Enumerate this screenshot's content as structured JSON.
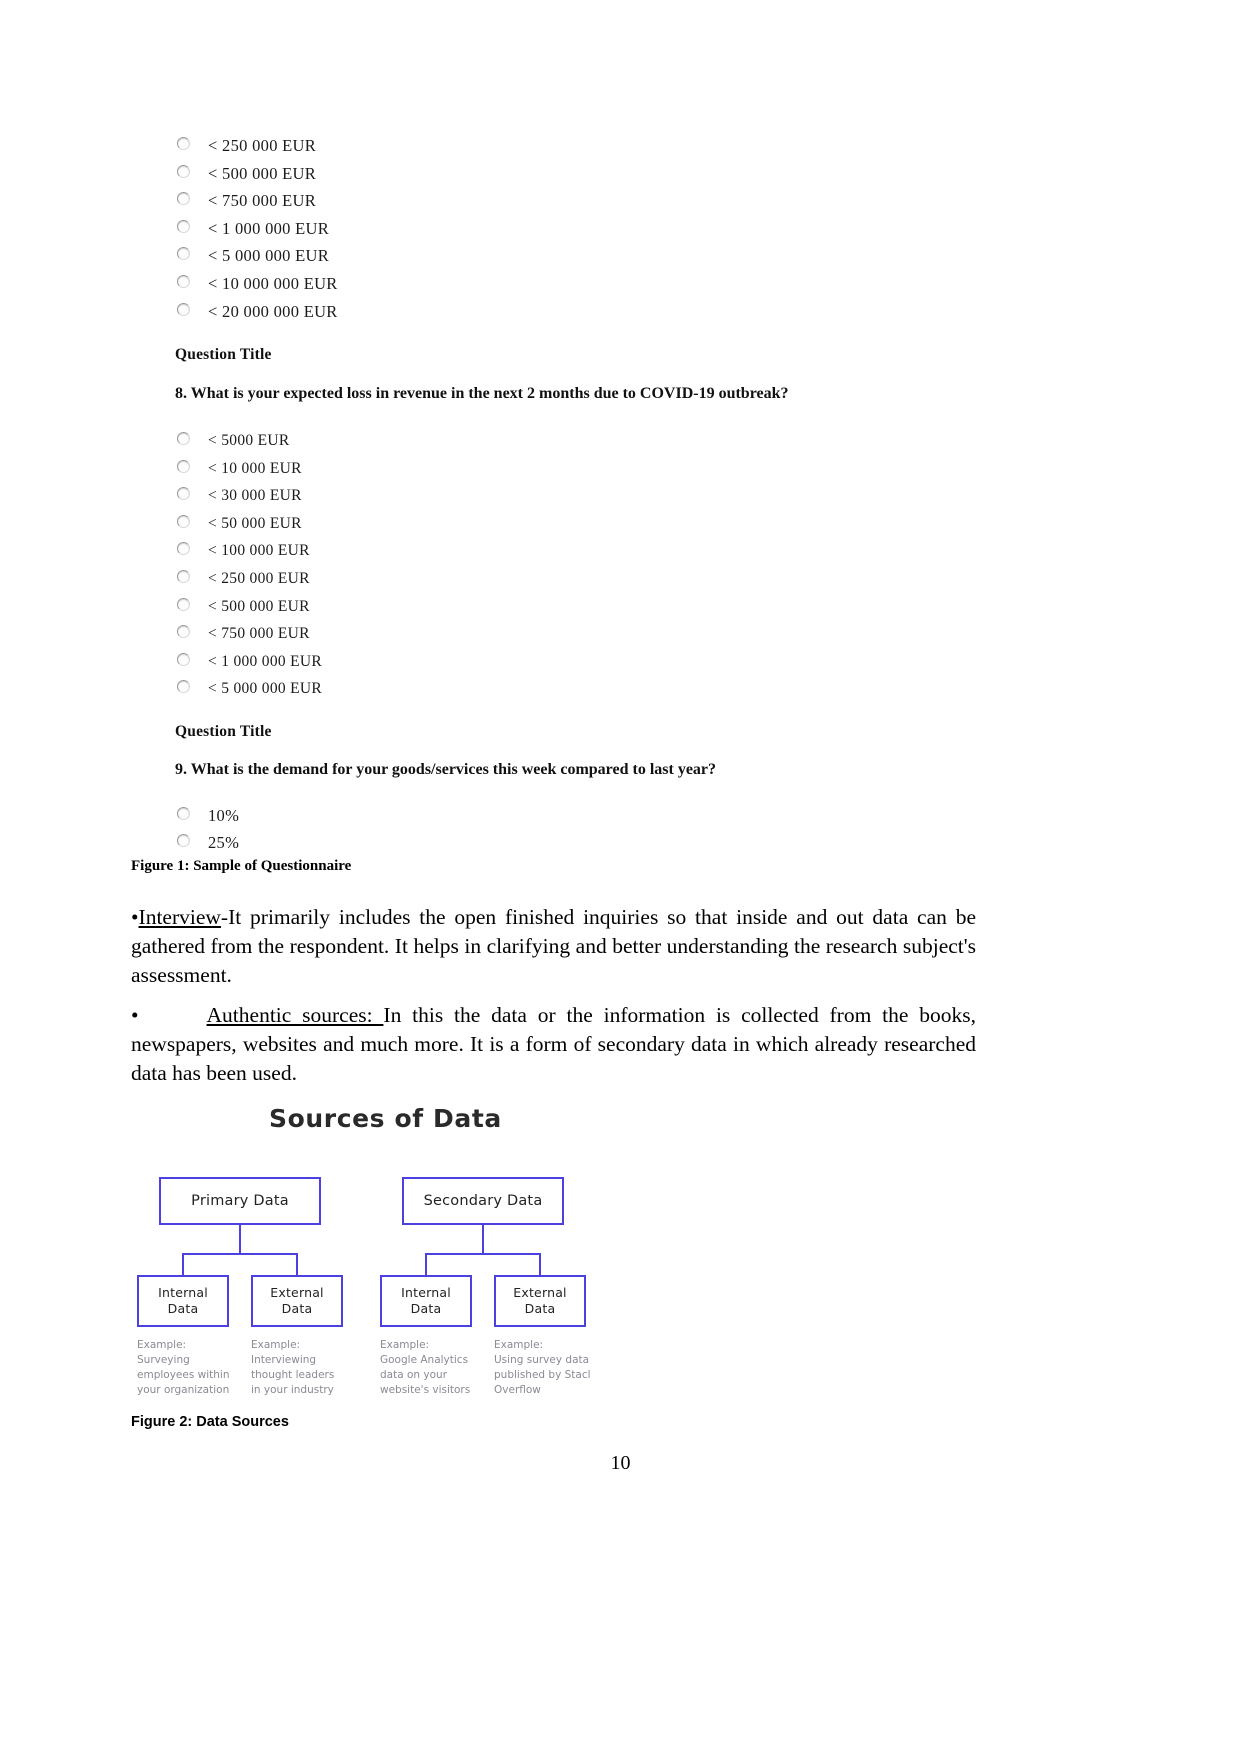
{
  "document": {
    "page_number": "10"
  },
  "questionnaire": {
    "q7_options": [
      "< 250 000 EUR",
      "< 500 000 EUR",
      "< 750 000 EUR",
      "< 1 000 000 EUR",
      "< 5 000 000 EUR",
      "< 10 000 000 EUR",
      "< 20 000 000 EUR"
    ],
    "q8_title": "Question Title",
    "q8_text": "8. What is your expected loss in revenue in the next 2 months due to COVID-19 outbreak?",
    "q8_options": [
      "< 5000 EUR",
      "< 10 000 EUR",
      "< 30 000 EUR",
      "< 50 000 EUR",
      "< 100 000 EUR",
      "< 250 000 EUR",
      "< 500 000 EUR",
      "< 750 000 EUR",
      "< 1 000 000 EUR",
      "< 5 000 000 EUR"
    ],
    "q9_title": "Question Title",
    "q9_text": "9. What is the demand for your goods/services this week compared to last year?",
    "q9_options": [
      "10%",
      "25%"
    ]
  },
  "figure1": {
    "caption": "Figure 1: Sample of Questionnaire"
  },
  "paragraphs": {
    "interview": {
      "bullet": "•",
      "term": "Interview",
      "rest": "-It primarily includes the open finished inquiries so that inside and out data can be gathered from the respondent. It helps in clarifying and better understanding the research subject's assessment."
    },
    "authentic": {
      "bullet": "•",
      "term": "Authentic sources: ",
      "rest": " In this the data or the information is collected from the books, newspapers, websites and much more. It is a form of secondary data in which already researched data has been used."
    }
  },
  "diagram": {
    "title": "Sources of Data",
    "accent_color": "#4b40e0",
    "primary": {
      "label": "Primary Data",
      "children": [
        {
          "label": "Internal\nData",
          "label_line1": "Internal",
          "label_line2": "Data",
          "example": "Example:\nSurveying\nemployees within\nyour organization"
        },
        {
          "label": "External\nData",
          "label_line1": "External",
          "label_line2": "Data",
          "example": "Example:\nInterviewing\nthought leaders\nin your industry"
        }
      ]
    },
    "secondary": {
      "label": "Secondary Data",
      "children": [
        {
          "label": "Internal\nData",
          "label_line1": "Internal",
          "label_line2": "Data",
          "example": "Example:\nGoogle Analytics\ndata on your\nwebsite's visitors"
        },
        {
          "label": "External\nData",
          "label_line1": "External",
          "label_line2": "Data",
          "example": "Example:\nUsing survey data\npublished by Stacl\nOverflow"
        }
      ]
    }
  },
  "figure2": {
    "caption": "Figure 2: Data Sources"
  }
}
